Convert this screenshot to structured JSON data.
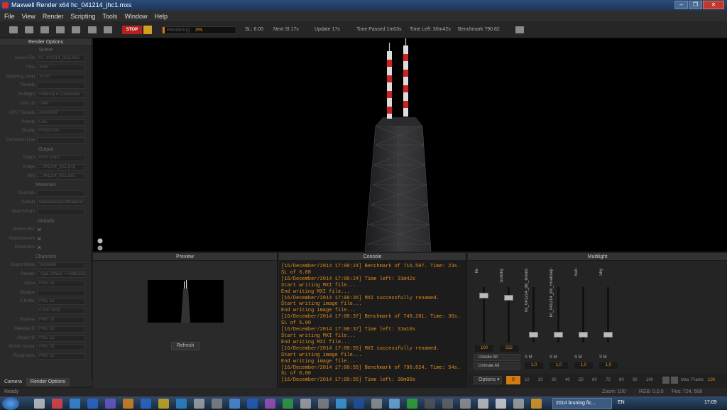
{
  "window": {
    "title": "Maxwell Render    x64    hc_041214_jhc1.mxs",
    "buttons": [
      "–",
      "❐",
      "✕"
    ]
  },
  "menu": [
    "File",
    "View",
    "Render",
    "Scripting",
    "Tools",
    "Window",
    "Help"
  ],
  "toolbar": {
    "stop_label": "STOP",
    "progress_label": "Rendering",
    "progress_pct": "3%",
    "progress_value": 0.03,
    "stats": [
      {
        "text": "SL: 6.00"
      },
      {
        "text": "Next Sl 17s"
      },
      {
        "text": "Update 17s"
      },
      {
        "text": "Time Passed 1m03s"
      },
      {
        "text": "Time Left: 30m42s"
      },
      {
        "text": "Benchmark 790.82"
      }
    ]
  },
  "left_panel": {
    "title": "Render Options",
    "sections": [
      {
        "label": "Scene",
        "rows": [
          {
            "label": "Scene File",
            "value": "hc_041214_jhc1.mxs"
          },
          {
            "label": "Time",
            "value": "3000"
          },
          {
            "label": "Sampling Level",
            "value": "15.00"
          },
          {
            "label": "Threads",
            "value": ""
          },
          {
            "label": "Multilight",
            "value": "Intensity ▾   Composite"
          },
          {
            "label": "CPU ID",
            "value": "1940"
          },
          {
            "label": "CPU Threads",
            "value": "Automatic"
          },
          {
            "label": "Priority",
            "value": "Low"
          },
          {
            "label": "Quality",
            "value": "Production"
          },
          {
            "label": "Command Line",
            "value": ""
          }
        ]
      },
      {
        "label": "Output",
        "rows": [
          {
            "label": "Depth",
            "value": "RGB 8 bpc"
          },
          {
            "label": "Image",
            "value": "...041214_jhc1.png"
          },
          {
            "label": "MXI",
            "value": "...041214_jhc1.mxi"
          }
        ]
      },
      {
        "label": "Materials",
        "rows": [
          {
            "label": "Override",
            "value": ""
          },
          {
            "label": "Default",
            "value": "MaxwellDefaultMaterial"
          },
          {
            "label": "Search Path",
            "value": ""
          }
        ]
      },
      {
        "label": "Globals",
        "rows": [
          {
            "label": "Motion Blur",
            "value": "✕"
          },
          {
            "label": "Displacement",
            "value": "✕"
          },
          {
            "label": "Dispersion",
            "value": "✕"
          }
        ]
      },
      {
        "label": "Channels",
        "rows": [
          {
            "label": "Output Mode",
            "value": "Separate"
          },
          {
            "label": "Render",
            "value": "Type  Diffuse + Reflection"
          },
          {
            "label": "Alpha",
            "value": "PNG 16"
          },
          {
            "label": "Opaque",
            "value": ""
          },
          {
            "label": "Z-buffer",
            "value": "PNG 16"
          },
          {
            "label": "",
            "value": "0.000   1000"
          },
          {
            "label": "Shadow",
            "value": "PNG 16"
          },
          {
            "label": "Material ID",
            "value": "PNG 16"
          },
          {
            "label": "Object ID",
            "value": "PNG 16"
          },
          {
            "label": "Motion Vector",
            "value": "PNG 16"
          },
          {
            "label": "Roughness",
            "value": "PNG 16"
          }
        ]
      }
    ],
    "tabs": [
      "Camera",
      "Render Options"
    ]
  },
  "preview": {
    "title": "Preview",
    "refresh_label": "Refresh"
  },
  "console": {
    "title": "Console",
    "lines": [
      "[16/December/2014 17:00:24] Benchmark of 716.507. Time: 23s.",
      "SL of 6.00",
      "[16/December/2014 17:00:24] Time left: 31m42s",
      "Start writing MXI file...",
      "End writing MXI file...",
      "[16/December/2014 17:00:35] MXI successfully renamed.",
      "Start writing image file...",
      "End writing image file...",
      "[16/December/2014 17:00:37] Benchmark of 749.201. Time: 36s.",
      "SL of 5.00",
      "[16/December/2014 17:00:37] Time left: 31m10s",
      "Start writing MXI file...",
      "End writing MXI file...",
      "[16/December/2014 17:00:55] MXI successfully renamed.",
      "Start writing image file...",
      "End writing image file...",
      "[16/December/2014 17:00:55] Benchmark of 790.824. Time: 54s.",
      "SL of 6.00",
      "[16/December/2014 17:00:55] Time left: 30m00s"
    ]
  },
  "multilight": {
    "title": "Multilight",
    "channels": [
      {
        "name": "Ile",
        "value": "100",
        "sm": "",
        "intensity": "",
        "level": 0.88
      },
      {
        "name": "Sunsky",
        "value": "522",
        "sm": "",
        "intensity": "",
        "level": 0.84
      },
      {
        "name": "hc_041214_jhc_Boxes",
        "value": "",
        "sm": "S   M",
        "intensity": "1,0",
        "level": 0.1
      },
      {
        "name": "hc_041214_jhc_Roadsep",
        "value": "",
        "sm": "S   M",
        "intensity": "1,0",
        "level": 0.1
      },
      {
        "name": "Sun",
        "value": "",
        "sm": "S   M",
        "intensity": "1,0",
        "level": 0.1
      },
      {
        "name": "Sky",
        "value": "",
        "sm": "S   M",
        "intensity": "1,0",
        "level": 0.1
      }
    ],
    "unsolo_label": "Unsolo All",
    "unmute_label": "Unmute All"
  },
  "timeline": {
    "options_label": "Options  ▾",
    "frame": "0",
    "ticks": [
      "10",
      "20",
      "30",
      "40",
      "50",
      "60",
      "70",
      "80",
      "90",
      "100"
    ],
    "maxframe_label": "Max. Frame",
    "maxframe": "100"
  },
  "status": {
    "left": "Ready",
    "zoom": "Zoom: 100",
    "rgb": "RGB: 0,0,0",
    "pos": "Pos: 724, 508"
  },
  "taskbar": {
    "task_label": "2014 bruning fic...",
    "lang": "EN",
    "clock": "17:09"
  }
}
